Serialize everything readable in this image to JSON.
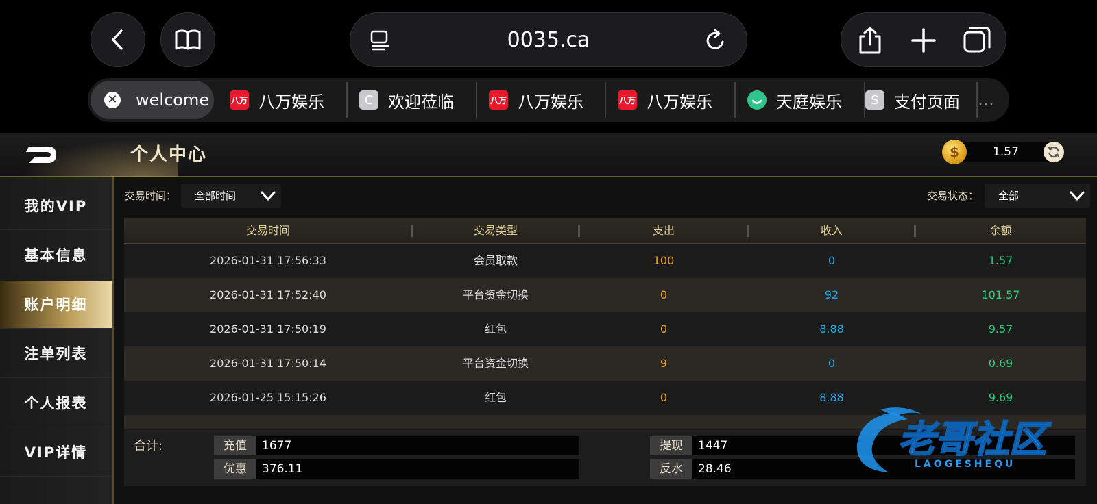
{
  "browser": {
    "url": "0035.ca",
    "tabs": [
      {
        "label": "welcome",
        "favicon": "close-icon"
      },
      {
        "label": "八万娱乐",
        "favicon_text": "八万"
      },
      {
        "label": "欢迎莅临",
        "favicon_text": "C"
      },
      {
        "label": "八万娱乐",
        "favicon_text": "八万"
      },
      {
        "label": "八万娱乐",
        "favicon_text": "八万"
      },
      {
        "label": "天庭娱乐",
        "favicon": "green-smile-icon"
      },
      {
        "label": "支付页面",
        "favicon_text": "S"
      },
      {
        "label": "…",
        "favicon": "overflow"
      }
    ]
  },
  "header": {
    "title": "个人中心",
    "balance": "1.57",
    "coin_symbol": "$"
  },
  "sidebar": {
    "items": [
      {
        "label": "我的VIP",
        "active": false
      },
      {
        "label": "基本信息",
        "active": false
      },
      {
        "label": "账户明细",
        "active": true
      },
      {
        "label": "注单列表",
        "active": false
      },
      {
        "label": "个人报表",
        "active": false
      },
      {
        "label": "VIP详情",
        "active": false
      }
    ]
  },
  "filters": {
    "time_label": "交易时间：",
    "time_value": "全部时间",
    "status_label": "交易状态：",
    "status_value": "全部"
  },
  "table": {
    "columns": [
      "交易时间",
      "交易类型",
      "支出",
      "收入",
      "余额"
    ],
    "rows": [
      {
        "time": "2026-01-31 17:56:33",
        "type": "会员取款",
        "out": "100",
        "in": "0",
        "balance": "1.57"
      },
      {
        "time": "2026-01-31 17:52:40",
        "type": "平台资金切换",
        "out": "0",
        "in": "92",
        "balance": "101.57"
      },
      {
        "time": "2026-01-31 17:50:19",
        "type": "红包",
        "out": "0",
        "in": "8.88",
        "balance": "9.57"
      },
      {
        "time": "2026-01-31 17:50:14",
        "type": "平台资金切换",
        "out": "9",
        "in": "0",
        "balance": "0.69"
      },
      {
        "time": "2026-01-25 15:15:26",
        "type": "红包",
        "out": "0",
        "in": "8.88",
        "balance": "9.69"
      }
    ]
  },
  "summary": {
    "label": "合计:",
    "recharge_label": "充值",
    "recharge_value": "1677",
    "withdraw_label": "提现",
    "withdraw_value": "1447",
    "bonus_label": "优惠",
    "bonus_value": "376.11",
    "rebate_label": "反水",
    "rebate_value": "28.46"
  },
  "watermark": {
    "text": "老哥社区",
    "subtext": "LAOGESHEQU"
  },
  "colors": {
    "gold": "#e2cf99",
    "expense": "#f0a020",
    "income": "#22a8e8",
    "balance": "#21d07a"
  }
}
